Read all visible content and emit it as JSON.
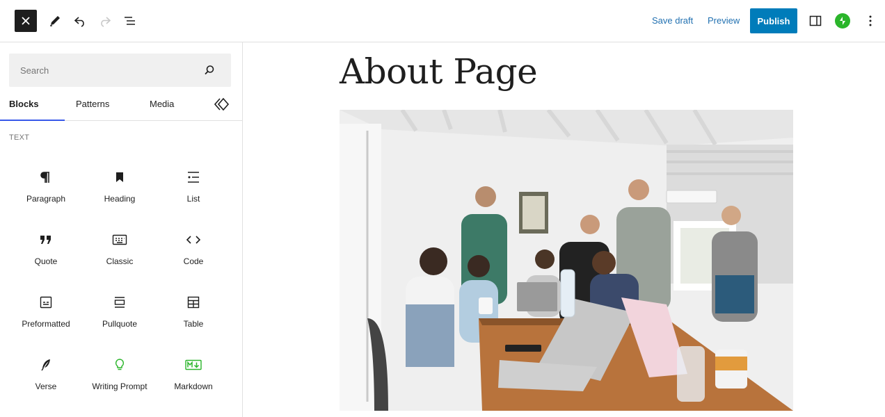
{
  "toolbar": {
    "save_draft": "Save draft",
    "preview": "Preview",
    "publish": "Publish"
  },
  "inserter": {
    "search_placeholder": "Search",
    "tabs": [
      "Blocks",
      "Patterns",
      "Media"
    ],
    "section_title": "TEXT",
    "blocks": [
      {
        "label": "Paragraph",
        "icon": "paragraph-icon"
      },
      {
        "label": "Heading",
        "icon": "heading-icon"
      },
      {
        "label": "List",
        "icon": "list-icon"
      },
      {
        "label": "Quote",
        "icon": "quote-icon"
      },
      {
        "label": "Classic",
        "icon": "classic-icon"
      },
      {
        "label": "Code",
        "icon": "code-icon"
      },
      {
        "label": "Preformatted",
        "icon": "preformatted-icon"
      },
      {
        "label": "Pullquote",
        "icon": "pullquote-icon"
      },
      {
        "label": "Table",
        "icon": "table-icon"
      },
      {
        "label": "Verse",
        "icon": "verse-icon"
      },
      {
        "label": "Writing Prompt",
        "icon": "writing-prompt-icon"
      },
      {
        "label": "Markdown",
        "icon": "markdown-icon"
      }
    ]
  },
  "editor": {
    "title": "About Page"
  },
  "colors": {
    "accent": "#3858e9",
    "link": "#2271b1",
    "publish": "#007cba",
    "jetpack": "#2bb52b"
  }
}
